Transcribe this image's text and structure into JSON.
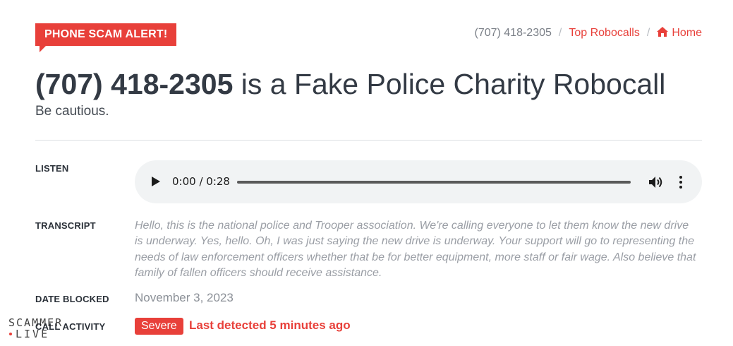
{
  "alert": {
    "badge": "PHONE SCAM ALERT!"
  },
  "breadcrumb": {
    "current": "(707) 418-2305",
    "separator": "/",
    "top_robocalls": "Top Robocalls",
    "home": "Home",
    "home_icon": "home-icon"
  },
  "header": {
    "phone": "(707) 418-2305",
    "title_rest": " is a Fake Police Charity Robocall",
    "subtitle": "Be cautious."
  },
  "listen": {
    "label": "LISTEN",
    "time": "0:00 / 0:28",
    "icons": {
      "play": "play-icon",
      "volume": "volume-icon",
      "more": "more-vertical-icon"
    }
  },
  "transcript": {
    "label": "TRANSCRIPT",
    "text": "Hello, this is the national police and Trooper association. We're calling everyone to let them know the new drive is underway. Yes, hello. Oh, I was just saying the new drive is underway. Your support will go to representing the needs of law enforcement officers whether that be for better equipment, more staff or fair wage. Also believe that family of fallen officers should receive assistance."
  },
  "date_blocked": {
    "label": "DATE BLOCKED",
    "value": "November 3, 2023"
  },
  "activity": {
    "label": "CALL ACTIVITY",
    "severity": "Severe",
    "last_detected": "Last detected 5 minutes ago"
  },
  "watermark": {
    "text": "SCAMMER LIVE"
  },
  "colors": {
    "accent": "#e8403a",
    "text": "#333a44",
    "muted": "#8b9097",
    "player_bg": "#f1f3f4"
  }
}
